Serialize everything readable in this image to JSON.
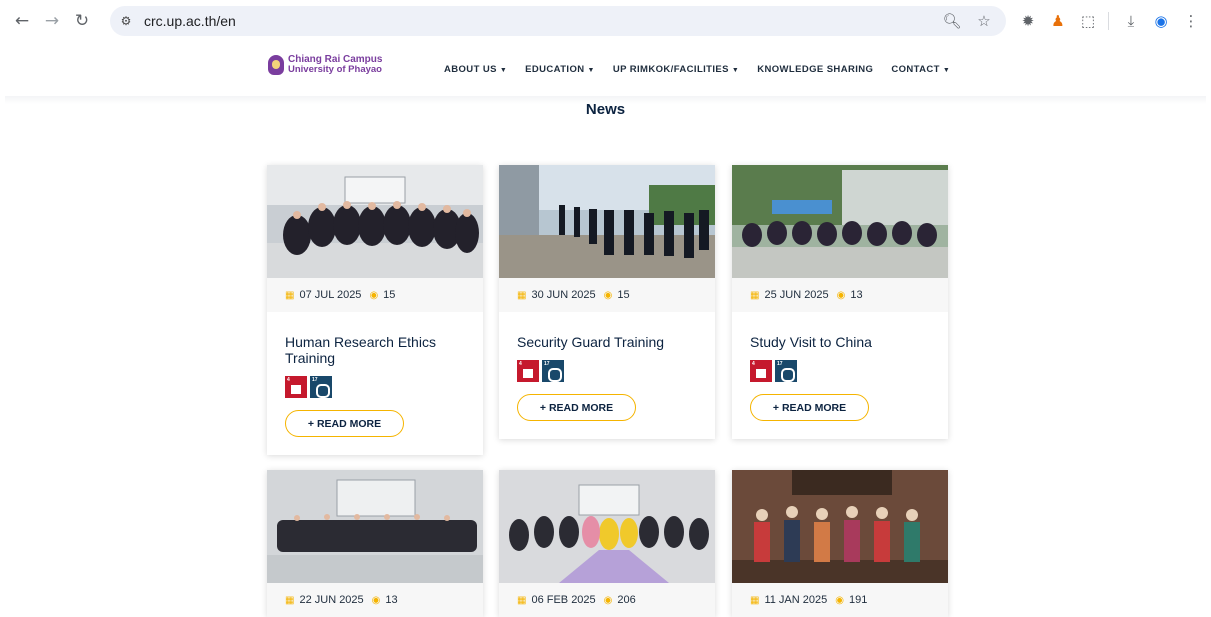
{
  "browser": {
    "url": "crc.up.ac.th/en",
    "icons": [
      "back-icon",
      "forward-icon",
      "reload-icon",
      "site-info-icon",
      "zoom-icon",
      "star-icon",
      "extension-bug-icon",
      "extension-avatar-icon",
      "extensions-puzzle-icon",
      "download-icon",
      "profile-icon",
      "menu-kebab-icon"
    ]
  },
  "site": {
    "logo_line1": "Chiang Rai Campus",
    "logo_line2": "University of Phayao",
    "menu": [
      {
        "label": "ABOUT US",
        "has_dropdown": true
      },
      {
        "label": "EDUCATION",
        "has_dropdown": true
      },
      {
        "label": "UP RIMKOK/FACILITIES",
        "has_dropdown": true
      },
      {
        "label": "KNOWLEDGE SHARING",
        "has_dropdown": false
      },
      {
        "label": "CONTACT",
        "has_dropdown": true
      }
    ],
    "section_title": "News"
  },
  "cards": [
    {
      "date": "07 JUL 2025",
      "views": "15",
      "title": "Human Research Ethics Training",
      "read_more": "+ READ MORE"
    },
    {
      "date": "30 JUN 2025",
      "views": "15",
      "title": "Security Guard Training",
      "read_more": "+ READ MORE"
    },
    {
      "date": "25 JUN 2025",
      "views": "13",
      "title": "Study Visit to China",
      "read_more": "+ READ MORE"
    },
    {
      "date": "22 JUN 2025",
      "views": "13"
    },
    {
      "date": "06 FEB 2025",
      "views": "206"
    },
    {
      "date": "11 JAN 2025",
      "views": "191"
    }
  ],
  "colors": {
    "accent": "#f5b400",
    "brand_purple": "#7a3d9e",
    "heading": "#0c2340",
    "sdg4": "#c5192d",
    "sdg17": "#19486a"
  }
}
